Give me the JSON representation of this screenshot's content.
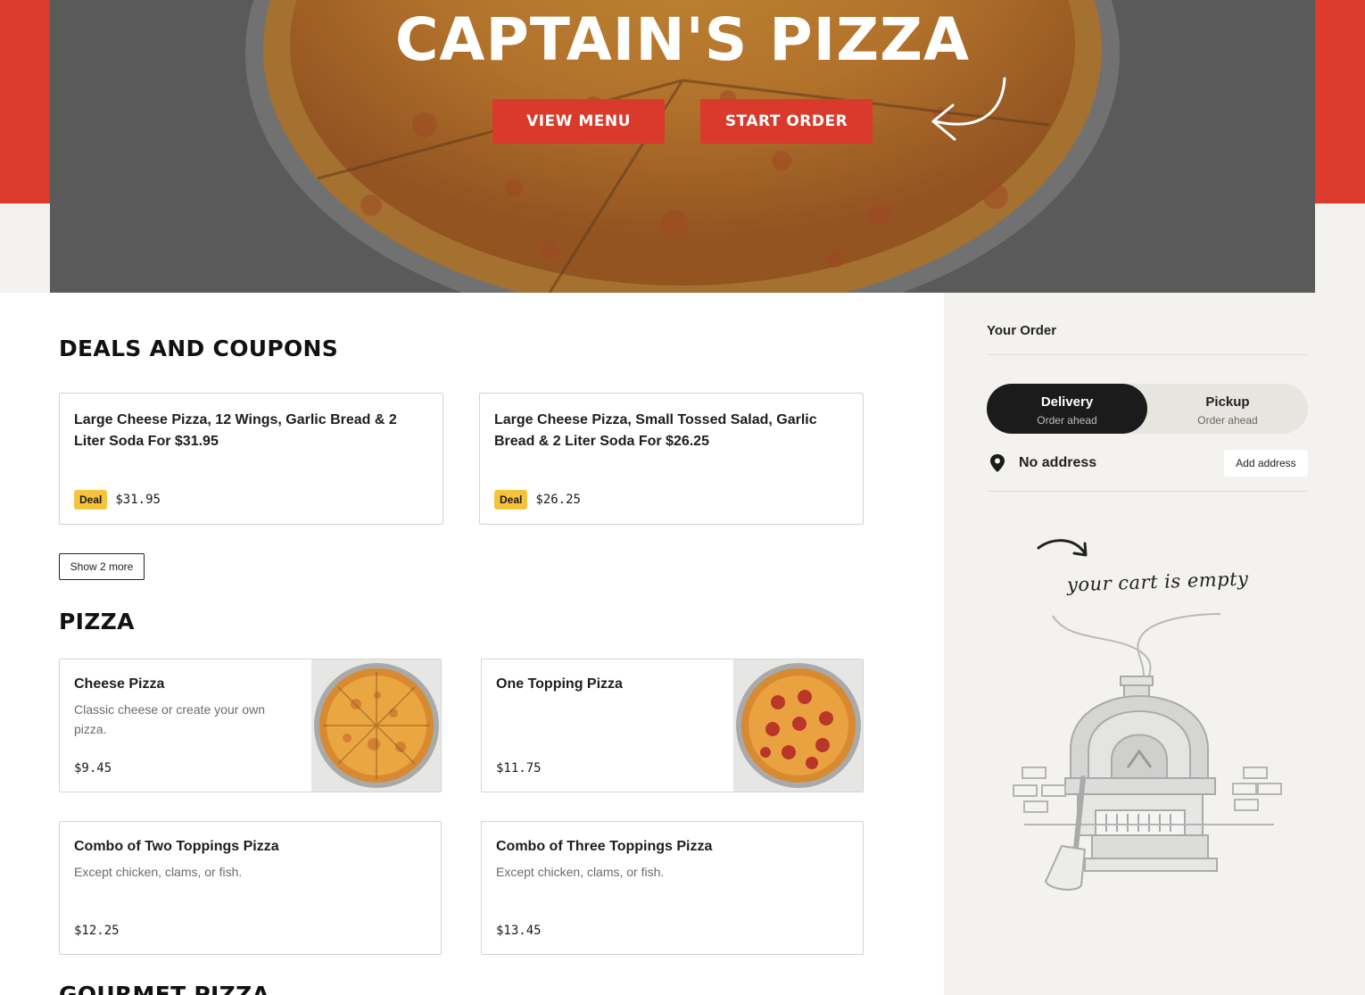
{
  "hero": {
    "title": "CAPTAIN'S PIZZA",
    "view_menu_label": "VIEW MENU",
    "start_order_label": "START ORDER"
  },
  "colors": {
    "brand_red": "#dc3a2c",
    "deal_badge": "#f6c43b",
    "sidebar_bg": "#f3f2ee",
    "toggle_active": "#1b1b1b"
  },
  "deals": {
    "title": "DEALS AND COUPONS",
    "items": [
      {
        "name": "Large Cheese Pizza, 12 Wings, Garlic Bread & 2 Liter Soda For $31.95",
        "badge": "Deal",
        "price": "$31.95"
      },
      {
        "name": "Large Cheese Pizza, Small Tossed Salad, Garlic Bread & 2 Liter Soda For $26.25",
        "badge": "Deal",
        "price": "$26.25"
      }
    ],
    "show_more_label": "Show 2 more"
  },
  "pizza": {
    "title": "PIZZA",
    "items": [
      {
        "name": "Cheese Pizza",
        "description": "Classic cheese or create your own pizza.",
        "price": "$9.45",
        "image": "cheese-pizza-photo"
      },
      {
        "name": "One Topping Pizza",
        "description": "",
        "price": "$11.75",
        "image": "pepperoni-pizza-photo"
      },
      {
        "name": "Combo of Two Toppings Pizza",
        "description": "Except chicken, clams, or fish.",
        "price": "$12.25"
      },
      {
        "name": "Combo of Three Toppings Pizza",
        "description": "Except chicken, clams, or fish.",
        "price": "$13.45"
      }
    ]
  },
  "next_section": {
    "title": "GOURMET PIZZA"
  },
  "order": {
    "title": "Your Order",
    "delivery": {
      "label": "Delivery",
      "sub": "Order ahead",
      "active": true
    },
    "pickup": {
      "label": "Pickup",
      "sub": "Order ahead",
      "active": false
    },
    "address_text": "No address",
    "add_address_label": "Add address",
    "empty_cart_text": "your cart is empty",
    "icons": {
      "location": "location-pin-icon",
      "arrow": "curved-arrow-icon",
      "illustration": "pizza-oven-illustration"
    }
  }
}
